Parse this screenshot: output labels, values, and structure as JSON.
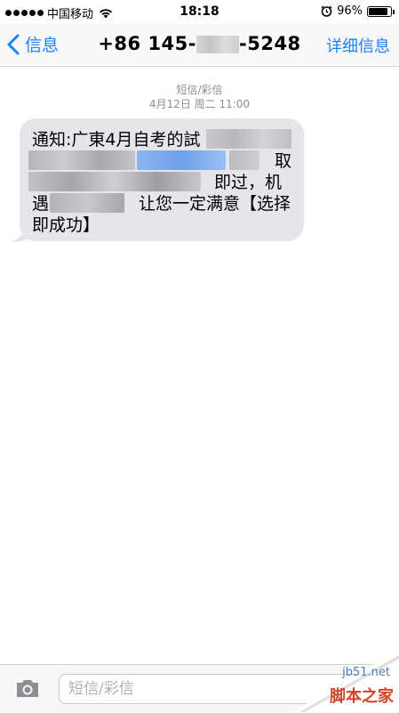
{
  "status": {
    "carrier": "中国移动",
    "time": "18:18",
    "battery_percent": "96%",
    "battery_level": 0.96
  },
  "nav": {
    "back_label": "信息",
    "title": "+86 145-",
    "title_suffix": "-5248",
    "details_label": "详细信息"
  },
  "thread": {
    "message_type": "短信/彩信",
    "date": "4月12日 周二 11:00"
  },
  "message": {
    "line1": "通知:广東4月自考的試",
    "line2_tail": "取",
    "line3_tail": "即过，机",
    "line4_tail": "让您一定满意【选择",
    "line5": "即成功】"
  },
  "input": {
    "placeholder": "短信/彩信"
  },
  "watermark": {
    "url": "jb51.net",
    "name": "脚本之家"
  },
  "colors": {
    "accent": "#1a82fb",
    "bubble": "#e5e5ea"
  }
}
